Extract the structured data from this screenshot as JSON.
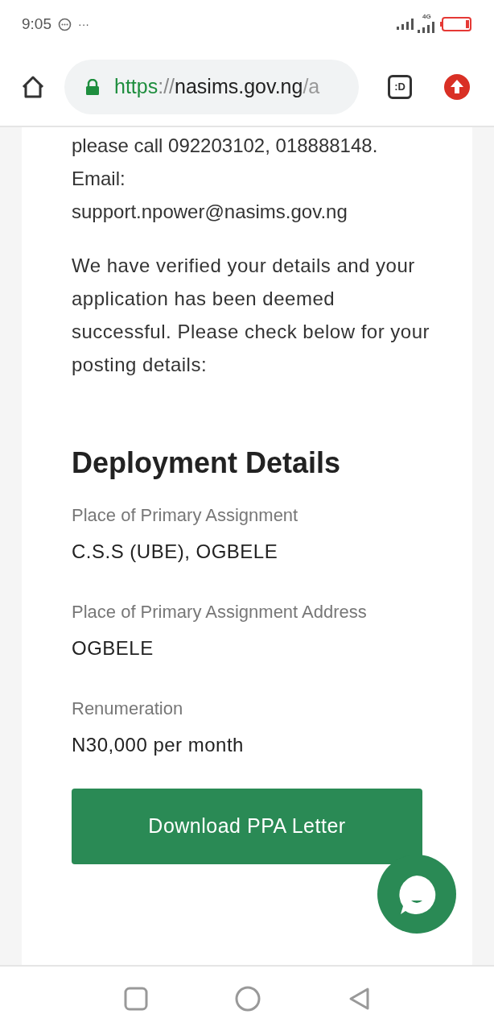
{
  "status_bar": {
    "time": "9:05",
    "overflow": "···",
    "network": "4G"
  },
  "browser": {
    "url_parts": [
      {
        "kind": "scheme",
        "text": "https"
      },
      {
        "kind": "sep",
        "text": "://"
      },
      {
        "kind": "host",
        "text": "nasims.gov.ng"
      },
      {
        "kind": "path",
        "text": "/a"
      }
    ],
    "tab_badge": ":D"
  },
  "content": {
    "contact_lines": [
      "please call 092203102, 018888148.",
      "Email:",
      "support.npower@nasims.gov.ng"
    ],
    "message": "We have verified your details and your application has been deemed successful. Please check below for your posting details:",
    "heading": "Deployment Details",
    "fields": [
      {
        "label": "Place of Primary Assignment",
        "value": "C.S.S (UBE), OGBELE"
      },
      {
        "label": "Place of Primary Assignment Address",
        "value": "OGBELE"
      },
      {
        "label": "Renumeration",
        "value": "N30,000 per month"
      }
    ],
    "button": "Download PPA Letter"
  }
}
